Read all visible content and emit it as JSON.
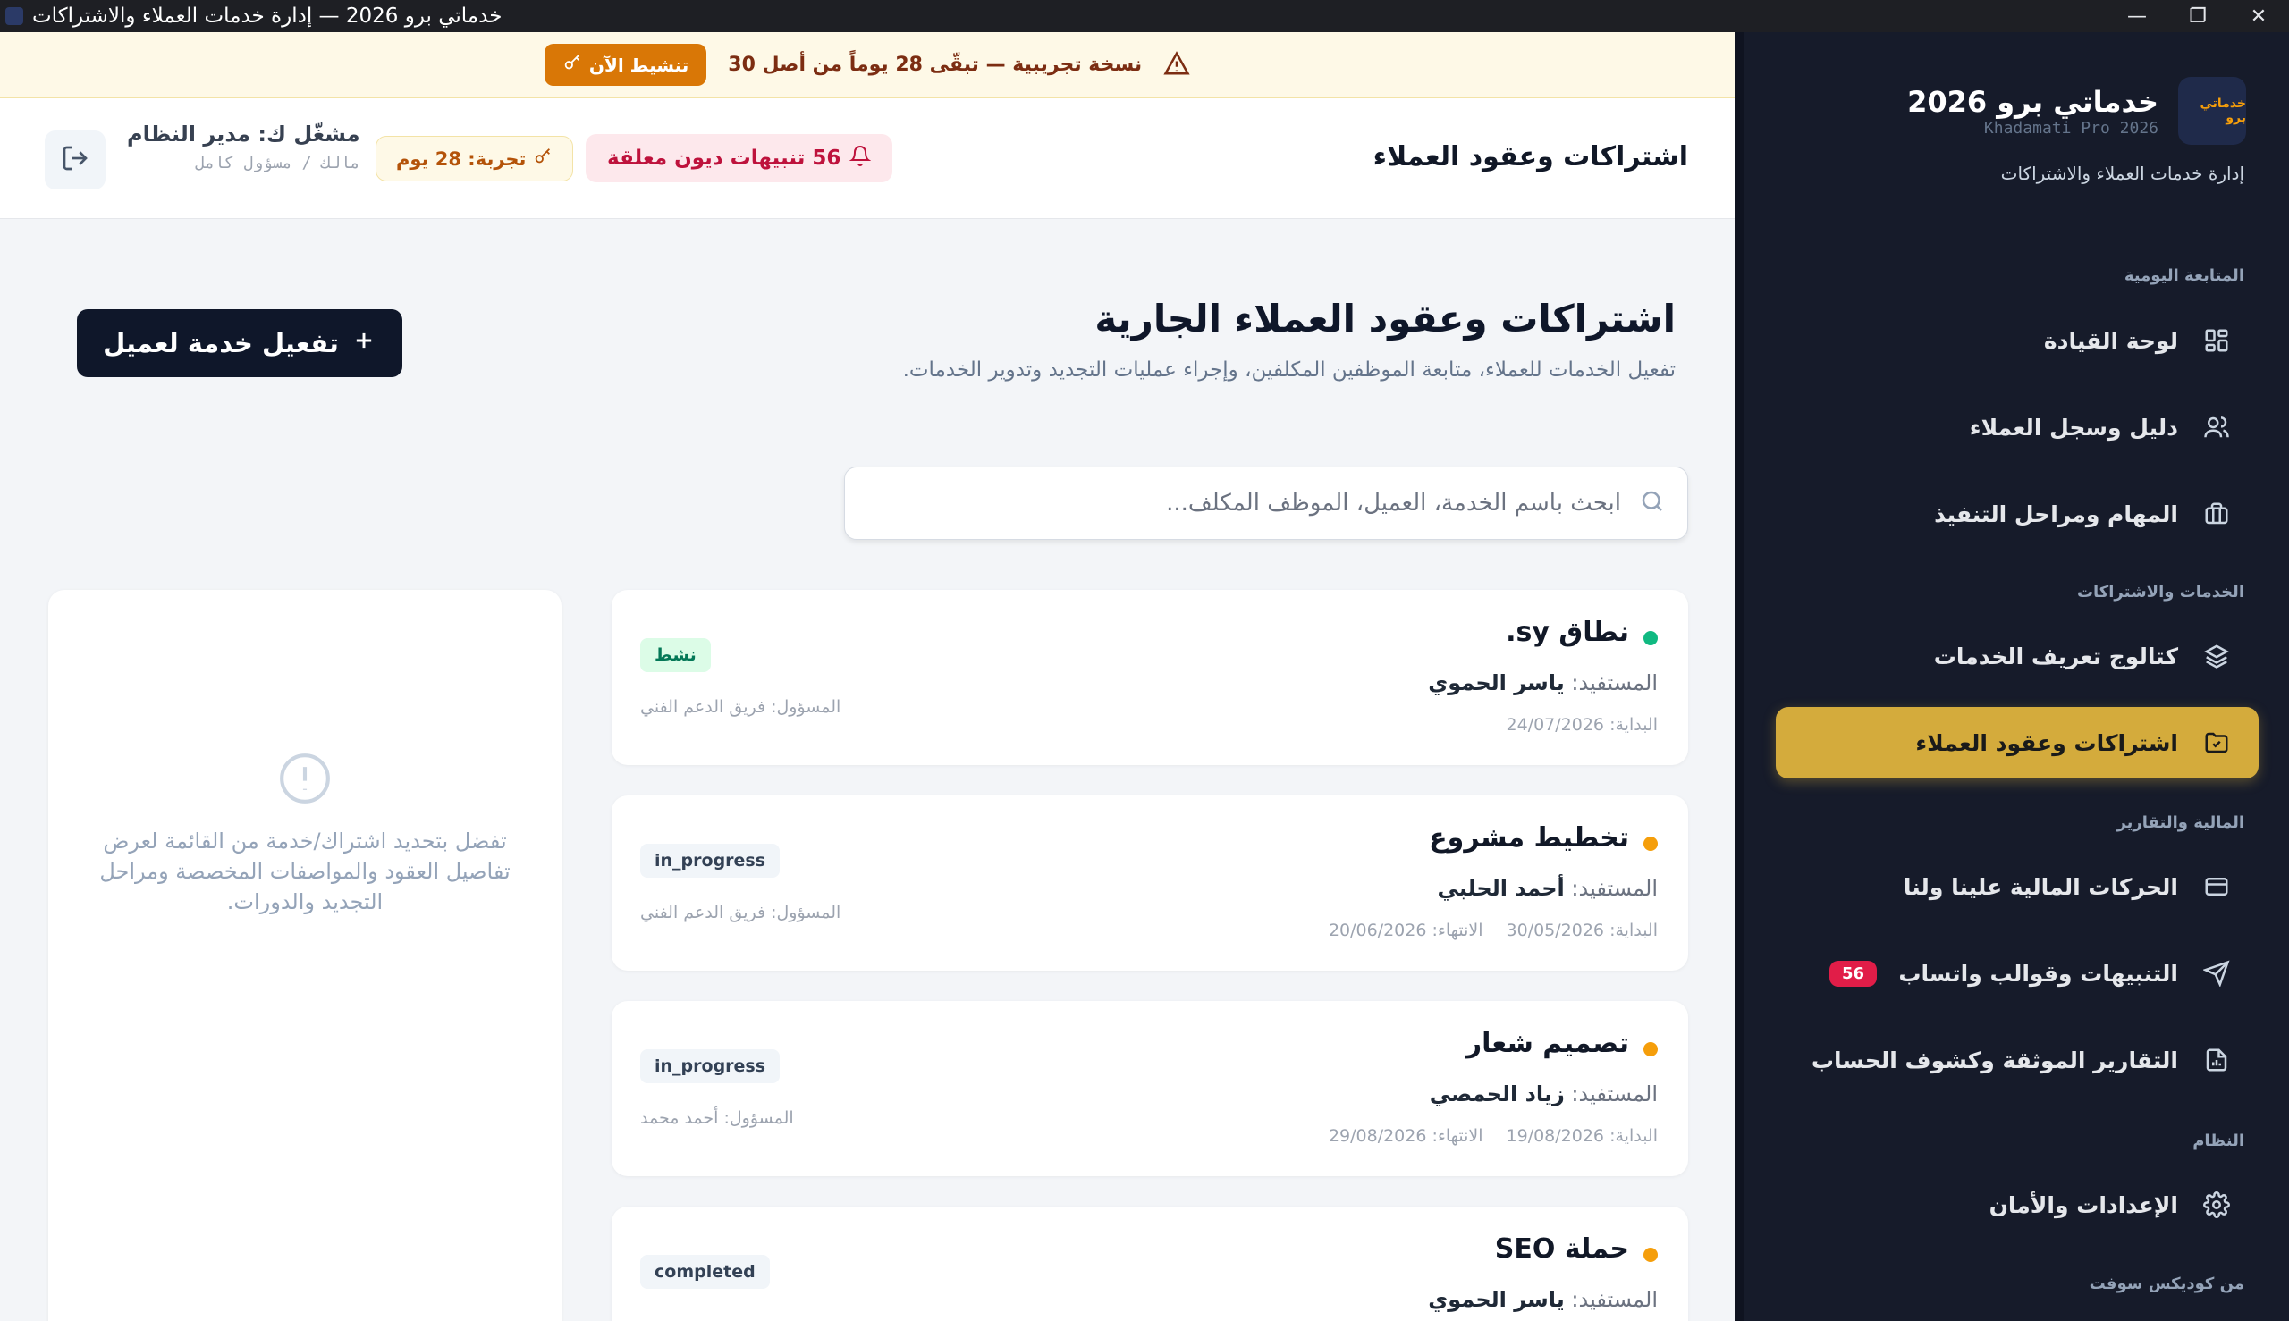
{
  "window": {
    "title": "خدماتي برو 2026 — إدارة خدمات العملاء والاشتراكات",
    "minimize": "—",
    "maximize": "❐",
    "close": "✕"
  },
  "sidebar": {
    "brand_name": "خدماتي برو 2026",
    "brand_sub": "Khadamati Pro 2026",
    "brand_logo_text": "خدماتي برو",
    "brand_desc": "إدارة خدمات العملاء والاشتراكات",
    "sections": {
      "daily": "المتابعة اليومية",
      "services": "الخدمات والاشتراكات",
      "finance": "المالية والتقارير",
      "system": "النظام",
      "from": "من كوديكس سوفت"
    },
    "items": [
      {
        "label": "لوحة القيادة",
        "icon": "dashboard-icon"
      },
      {
        "label": "دليل وسجل العملاء",
        "icon": "users-icon"
      },
      {
        "label": "المهام ومراحل التنفيذ",
        "icon": "briefcase-icon"
      },
      {
        "label": "كتالوج تعريف الخدمات",
        "icon": "layers-icon"
      },
      {
        "label": "اشتراكات وعقود العملاء",
        "icon": "folder-check-icon"
      },
      {
        "label": "الحركات المالية علينا ولنا",
        "icon": "card-icon"
      },
      {
        "label": "التنبيهات وقوالب واتساب",
        "icon": "send-icon",
        "badge": "56"
      },
      {
        "label": "التقارير الموثقة وكشوف الحساب",
        "icon": "report-icon"
      },
      {
        "label": "الإعدادات والأمان",
        "icon": "gear-icon"
      }
    ]
  },
  "banner": {
    "text": "نسخة تجريبية — تبقّى 28 يوماً من أصل 30",
    "button": "تنشيط الآن"
  },
  "header": {
    "title": "اشتراكات وعقود العملاء",
    "alerts": "56 تنبيهات ديون معلقة",
    "trial": "تجربة: 28 يوم",
    "user_name": "مشغّل ك: مدير النظام",
    "user_role": "مالك / مسؤول كامل"
  },
  "main": {
    "title": "اشتراكات وعقود العملاء الجارية",
    "subtitle": "تفعيل الخدمات للعملاء، متابعة الموظفين المكلفين، وإجراء عمليات التجديد وتدوير الخدمات.",
    "add_button": "تفعيل خدمة لعميل",
    "search_placeholder": "ابحث باسم الخدمة، العميل، الموظف المكلف...",
    "details_empty": "تفضل بتحديد اشتراك/خدمة من القائمة لعرض تفاصيل العقود والمواصفات المخصصة ومراحل التجديد والدورات."
  },
  "cards": [
    {
      "title": "نطاق sy.",
      "beneficiary_label": "المستفيد:",
      "beneficiary": "ياسر الحموي",
      "start": "البداية: 24/07/2026",
      "end": "",
      "status": "نشط",
      "owner": "المسؤول: فريق الدعم الفني",
      "dot": "#10b981"
    },
    {
      "title": "تخطيط مشروع",
      "beneficiary_label": "المستفيد:",
      "beneficiary": "أحمد الحلبي",
      "start": "البداية: 30/05/2026",
      "end": "الانتهاء: 20/06/2026",
      "status": "in_progress",
      "owner": "المسؤول: فريق الدعم الفني",
      "dot": "#f59e0b"
    },
    {
      "title": "تصميم شعار",
      "beneficiary_label": "المستفيد:",
      "beneficiary": "زياد الحمصي",
      "start": "البداية: 19/08/2026",
      "end": "الانتهاء: 29/08/2026",
      "status": "in_progress",
      "owner": "المسؤول: أحمد محمد",
      "dot": "#f59e0b"
    },
    {
      "title": "حملة SEO",
      "beneficiary_label": "المستفيد:",
      "beneficiary": "ياسر الحموي",
      "start": "",
      "end": "",
      "status": "completed",
      "owner": "",
      "dot": "#f59e0b"
    }
  ],
  "colors": {
    "sidebar_bg": "#161b2a",
    "active_item": "#d4ab3c",
    "primary": "#0f172a",
    "alert": "#be123c",
    "trial": "#d97706"
  }
}
